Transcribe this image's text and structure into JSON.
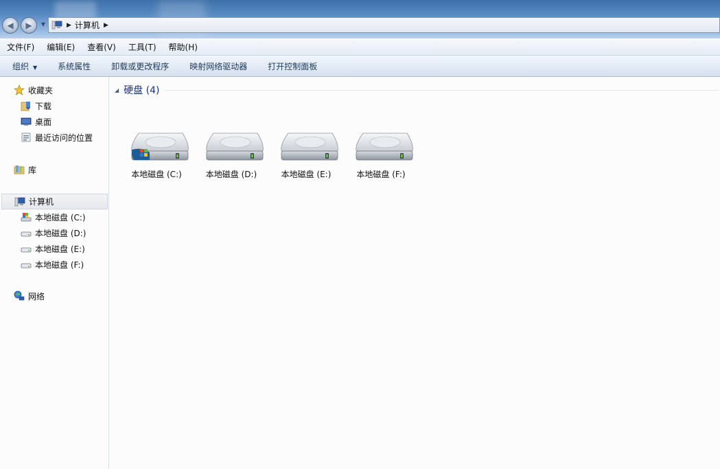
{
  "address": {
    "crumb": "计算机"
  },
  "menu": [
    "文件(F)",
    "编辑(E)",
    "查看(V)",
    "工具(T)",
    "帮助(H)"
  ],
  "commands": {
    "organize": "组织",
    "system_properties": "系统属性",
    "uninstall": "卸载或更改程序",
    "map_drive": "映射网络驱动器",
    "control_panel": "打开控制面板"
  },
  "nav": {
    "favorites": "收藏夹",
    "downloads": "下载",
    "desktop": "桌面",
    "recent": "最近访问的位置",
    "libraries": "库",
    "computer": "计算机",
    "drive_c": "本地磁盘 (C:)",
    "drive_d": "本地磁盘 (D:)",
    "drive_e": "本地磁盘 (E:)",
    "drive_f": "本地磁盘 (F:)",
    "network": "网络"
  },
  "content": {
    "group_title": "硬盘 (4)",
    "drives": [
      {
        "label": "本地磁盘 (C:)",
        "icon": "system-drive-icon"
      },
      {
        "label": "本地磁盘 (D:)",
        "icon": "hard-drive-icon"
      },
      {
        "label": "本地磁盘 (E:)",
        "icon": "hard-drive-icon"
      },
      {
        "label": "本地磁盘 (F:)",
        "icon": "hard-drive-icon"
      }
    ]
  },
  "colors": {
    "group_title": "#1e3287",
    "command_text": "#1e395b",
    "titlebar": "#5a8cc4"
  }
}
